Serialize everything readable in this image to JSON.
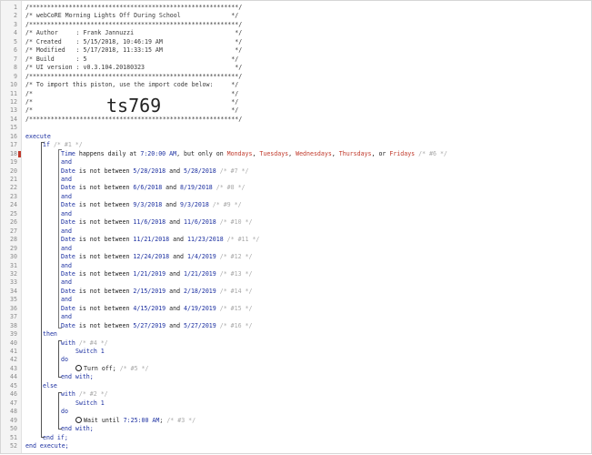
{
  "editor": {
    "lines": [
      {
        "n": "1",
        "t": "/**********************************************************/"
      },
      {
        "n": "2",
        "t": "/* webCoRE Morning Lights Off During School              */"
      },
      {
        "n": "3",
        "t": "/**********************************************************/"
      },
      {
        "n": "4",
        "t": "/* Author     : Frank Jannuzzi                            */"
      },
      {
        "n": "5",
        "t": "/* Created    : 5/15/2018, 10:46:19 AM                    */"
      },
      {
        "n": "6",
        "t": "/* Modified   : 5/17/2018, 11:33:15 AM                    */"
      },
      {
        "n": "7",
        "t": "/* Build      : 5                                        */"
      },
      {
        "n": "8",
        "t": "/* UI version : v0.3.104.20180323                         */"
      },
      {
        "n": "9",
        "t": "/**********************************************************/"
      },
      {
        "n": "10",
        "t": "/* To import this piston, use the import code below:     */"
      },
      {
        "n": "11",
        "t": "/*                                                       */"
      },
      {
        "n": "12",
        "t": "/*                                                       */"
      },
      {
        "n": "13",
        "t": "/*                                                       */"
      },
      {
        "n": "14",
        "t": "/**********************************************************/"
      },
      {
        "n": "15",
        "t": ""
      },
      {
        "n": "16",
        "t": "execute"
      },
      {
        "n": "17",
        "t": "if /* #1 */"
      },
      {
        "n": "18",
        "t": "Time happens daily at 7:20:00 AM, but only on Mondays, Tuesdays, Wednesdays, Thursdays, or Fridays /* #6 */"
      },
      {
        "n": "19",
        "t": "and"
      },
      {
        "n": "20",
        "t": "Date is not between 5/28/2018 and 5/28/2018 /* #7 */"
      },
      {
        "n": "21",
        "t": "and"
      },
      {
        "n": "22",
        "t": "Date is not between 6/6/2018 and 8/19/2018 /* #8 */"
      },
      {
        "n": "23",
        "t": "and"
      },
      {
        "n": "24",
        "t": "Date is not between 9/3/2018 and 9/3/2018 /* #9 */"
      },
      {
        "n": "25",
        "t": "and"
      },
      {
        "n": "26",
        "t": "Date is not between 11/6/2018 and 11/6/2018 /* #10 */"
      },
      {
        "n": "27",
        "t": "and"
      },
      {
        "n": "28",
        "t": "Date is not between 11/21/2018 and 11/23/2018 /* #11 */"
      },
      {
        "n": "29",
        "t": "and"
      },
      {
        "n": "30",
        "t": "Date is not between 12/24/2018 and 1/4/2019 /* #12 */"
      },
      {
        "n": "31",
        "t": "and"
      },
      {
        "n": "32",
        "t": "Date is not between 1/21/2019 and 1/21/2019 /* #13 */"
      },
      {
        "n": "33",
        "t": "and"
      },
      {
        "n": "34",
        "t": "Date is not between 2/15/2019 and 2/18/2019 /* #14 */"
      },
      {
        "n": "35",
        "t": "and"
      },
      {
        "n": "36",
        "t": "Date is not between 4/15/2019 and 4/19/2019 /* #15 */"
      },
      {
        "n": "37",
        "t": "and"
      },
      {
        "n": "38",
        "t": "Date is not between 5/27/2019 and 5/27/2019 /* #16 */"
      },
      {
        "n": "39",
        "t": "then"
      },
      {
        "n": "40",
        "t": "with /* #4 */"
      },
      {
        "n": "41",
        "t": "Switch 1"
      },
      {
        "n": "42",
        "t": "do"
      },
      {
        "n": "43",
        "t": "Turn off; /* #5 */"
      },
      {
        "n": "44",
        "t": "end with;"
      },
      {
        "n": "45",
        "t": "else"
      },
      {
        "n": "46",
        "t": "with /* #2 */"
      },
      {
        "n": "47",
        "t": "Switch 1"
      },
      {
        "n": "48",
        "t": "do"
      },
      {
        "n": "49",
        "t": "Wait until 7:25:00 AM; /* #3 */"
      },
      {
        "n": "50",
        "t": "end with;"
      },
      {
        "n": "51",
        "t": "end if;"
      },
      {
        "n": "52",
        "t": "end execute;"
      }
    ],
    "import_code": "ts769",
    "error_line": "18"
  },
  "colors": {
    "keyword": "#1b2fa0",
    "comment_dim": "#a9a9a9",
    "day_highlight": "#c0392b",
    "gutter": "#f4f4f4"
  }
}
